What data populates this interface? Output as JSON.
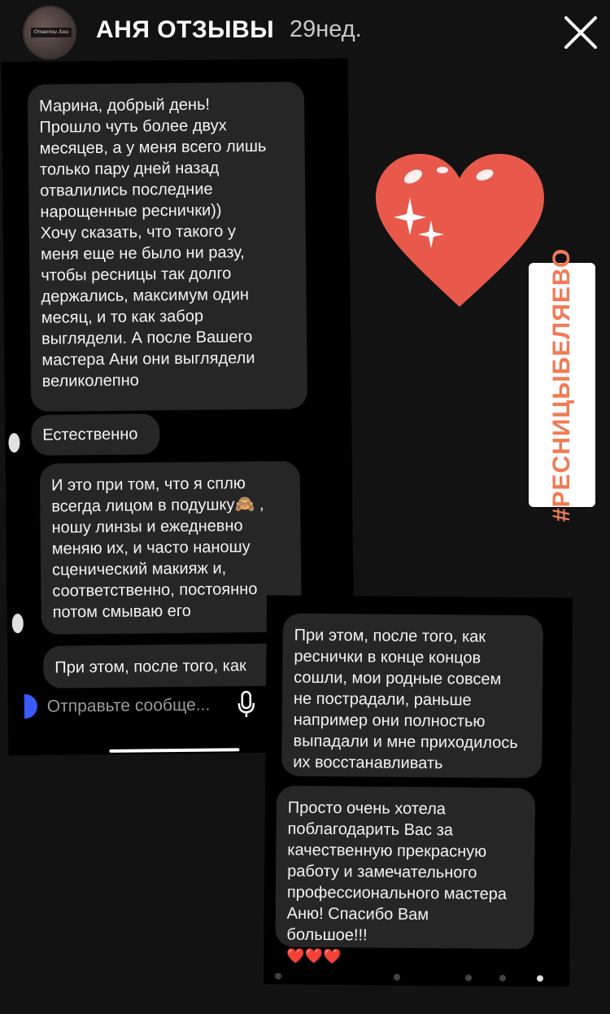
{
  "header": {
    "account_name": "АНЯ ОТЗЫВЫ",
    "time_ago": "29нед.",
    "avatar_text": "Ответы Ани",
    "close_icon": "close-icon"
  },
  "left_screenshot": {
    "messages": [
      "Марина, добрый день!\nПрошло чуть более двух\nмесяцев, а у меня всего лишь\nтолько пару дней назад\nотвалились последние\nнарощенные реснички))\nХочу сказать, что такого у\nменя еще не было ни разу,\nчтобы ресницы так долго\nдержались, максимум один\nмесяц, и то как забор\nвыглядели. А после Вашего\nмастера Ани они выглядели\nвеликолепно",
      "Естественно",
      "И это при том, что я сплю\nвсегда лицом в подушку🙈 ,\nношу линзы и ежедневно\nменяю их, и часто наношу\nсценический макияж и,\nсоответственно, постоянно\nпотом смываю его",
      "При этом, после того, как"
    ],
    "composer_placeholder": "Отправьте сообще...",
    "icons": [
      "camera-icon",
      "microphone-icon"
    ]
  },
  "right_screenshot": {
    "messages": [
      "При этом, после того, как\nреснички в конце концов\nсошли, мои родные совсем\nне пострадали, раньше\nнапример они полностью\nвыпадали и мне приходилось\nих восстанавливать",
      "Просто очень хотела\nпоблагодарить Вас за\nкачественную прекрасную\nработу и замечательного\nпрофессионального мастера\nАню! Спасибо Вам\nбольшое!!!"
    ],
    "hearts": "❤️❤️❤️"
  },
  "stickers": {
    "heart": "heart-sparkle-sticker",
    "hashtag": "#РЕСНИЦЫБЕЛЯЕВО",
    "hashtag_color": "#f07b55",
    "heart_color": "#e8594c"
  }
}
